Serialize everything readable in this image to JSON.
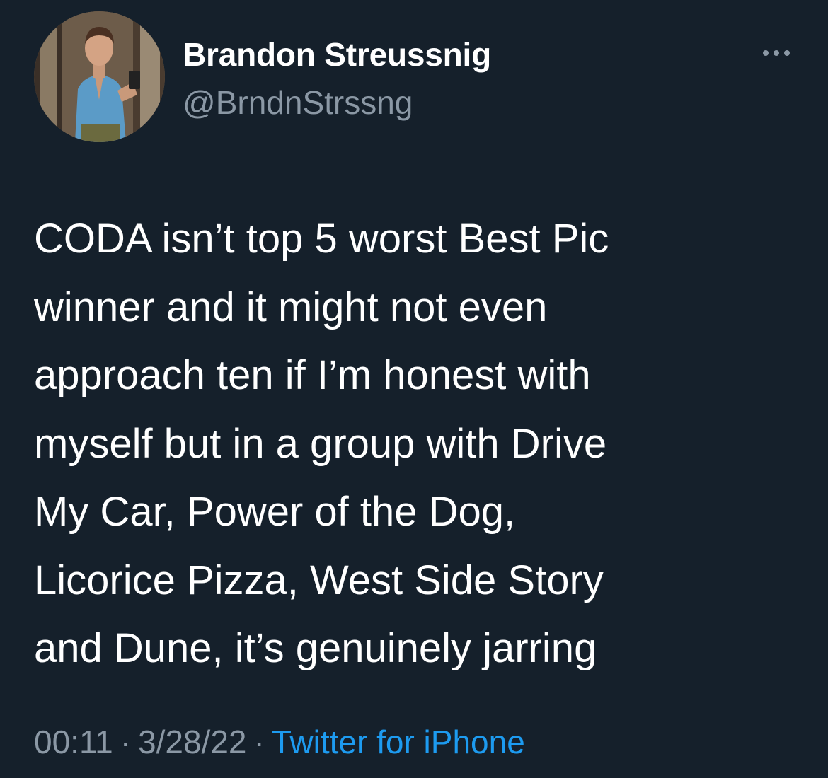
{
  "tweet": {
    "author": {
      "display_name": "Brandon Streussnig",
      "handle": "@BrndnStrssng"
    },
    "text": "CODA isn’t top 5 worst Best Pic\nwinner and it might not even\napproach ten if I’m honest with\nmyself but in a group with Drive\nMy Car, Power of the Dog,\nLicorice Pizza, West Side Story\nand Dune, it’s genuinely jarring",
    "time": "00:11",
    "separator": "·",
    "date": "3/28/22",
    "source": "Twitter for iPhone"
  },
  "icons": {
    "more": "more-horizontal-icon",
    "avatar": "profile-photo"
  },
  "colors": {
    "background": "#15202b",
    "text_primary": "#ffffff",
    "text_secondary": "#8b98a5",
    "accent": "#1d9bf0"
  }
}
